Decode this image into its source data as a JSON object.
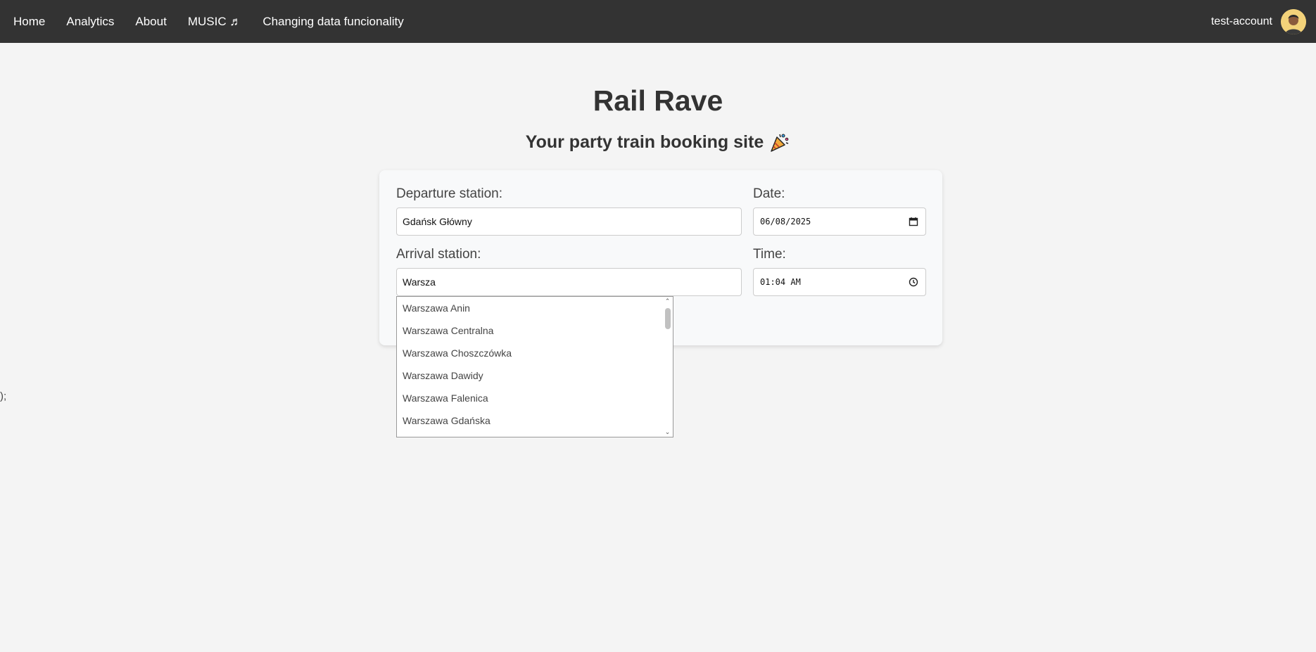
{
  "nav": {
    "links": [
      "Home",
      "Analytics",
      "About",
      "MUSIC ♬",
      "Changing data funcionality"
    ],
    "username": "test-account",
    "avatar_icon": "user-avatar-icon"
  },
  "hero": {
    "title": "Rail Rave",
    "subtitle": "Your party train booking site",
    "subtitle_icon": "party-popper-icon"
  },
  "form": {
    "departure_label": "Departure station:",
    "departure_value": "Gdańsk Główny",
    "date_label": "Date:",
    "date_value": "06/08/2025",
    "arrival_label": "Arrival station:",
    "arrival_value": "Warsza",
    "time_label": "Time:",
    "time_value": "01:04 AM"
  },
  "suggestions": [
    "Warszawa Anin",
    "Warszawa Centralna",
    "Warszawa Choszczówka",
    "Warszawa Dawidy",
    "Warszawa Falenica",
    "Warszawa Gdańska"
  ],
  "stray_text": ");",
  "colors": {
    "navbar": "#333333",
    "background": "#f4f4f4",
    "card": "#f8f9fa"
  }
}
